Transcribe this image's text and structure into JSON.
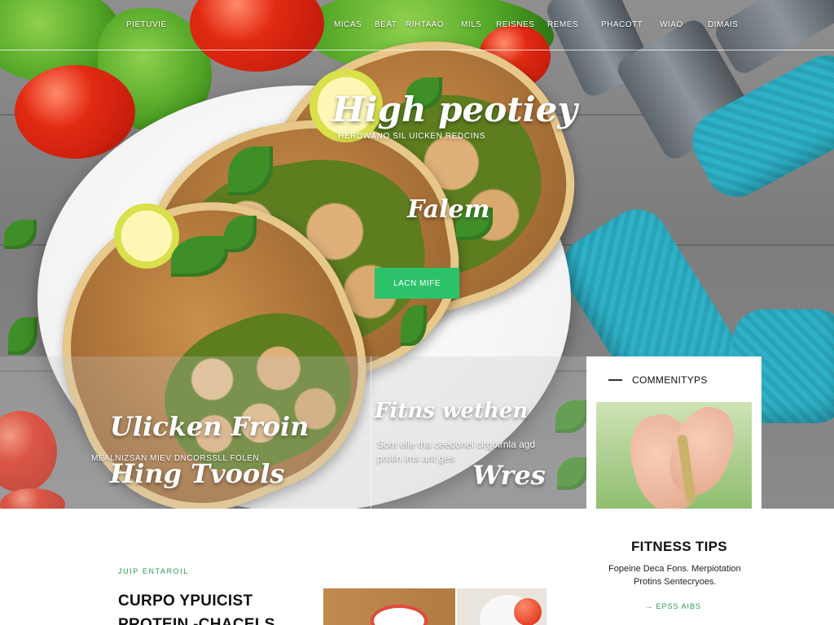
{
  "nav": {
    "brand": "PIETUVIE",
    "items": [
      "MICAS",
      "BEAT",
      "RIHTAAO",
      "MILS",
      "REISNES",
      "REMES",
      "PHACOTT",
      "WIAO",
      "DIMAIS"
    ]
  },
  "hero": {
    "title": "High peotiey",
    "subtitle": "HERDWANO SIL UICKEN REDCINS",
    "script": "Falem",
    "cta_label": "LACN MIFE"
  },
  "band": {
    "left_title": "Ulicken Froin",
    "left_subtitle": "MEALNIZSAN MIEV DNCORSSLL FOLEN",
    "left_title_2": "Hing Tvools",
    "mid_title": "Fitns wethen",
    "mid_description": "Som elle tha ceedonel cirgoirnla agd protin lms ant ges",
    "right_title": "Wres"
  },
  "community": {
    "title": "COMMENITYPS"
  },
  "section": {
    "eyebrow": "JUIP ENTAROIL",
    "heading_line1": "CURPO YPUICIST",
    "heading_line2": "PROTEIN -CHACELS"
  },
  "tips": {
    "title": "FITNESS TIPS",
    "line1": "Fopeine Deca Fons. Merpiotation",
    "line2": "Protins Sentecryoes.",
    "link": "→ EPSS AIBS"
  },
  "colors": {
    "accent_green": "#2bc26a",
    "eyebrow_green": "#2a9a55",
    "dumbbell_teal": "#2fb2c8"
  }
}
